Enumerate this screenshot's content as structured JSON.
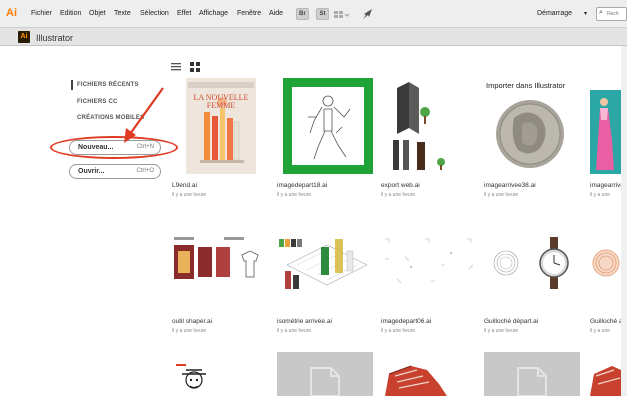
{
  "menubar": {
    "logo": "Ai",
    "items": [
      "Fichier",
      "Edition",
      "Objet",
      "Texte",
      "Sélection",
      "Effet",
      "Affichage",
      "Fenêtre",
      "Aide"
    ],
    "bridge_btn": "Br",
    "stock_btn": "St",
    "workspace": "Démarrage",
    "search_placeholder": "Rech"
  },
  "appbar": {
    "logo": "Ai",
    "title": "Illustrator"
  },
  "sidebar": {
    "links": [
      "FICHIERS RÉCENTS",
      "FICHIERS CC",
      "CRÉATIONS MOBILES"
    ],
    "new_button": {
      "label": "Nouveau...",
      "shortcut": "Ctrl+N"
    },
    "open_button": {
      "label": "Ouvrir...",
      "shortcut": "Ctrl+O"
    }
  },
  "files": [
    {
      "name": "L9end.ai",
      "time": "il y a une heure",
      "thumb_title": "LA NOUVELLE FEMME"
    },
    {
      "name": "imagedepart18.ai",
      "time": "il y a une heure"
    },
    {
      "name": "export web.ai",
      "time": "il y a une heure"
    },
    {
      "name": "imagearrivee38.ai",
      "time": "il y a une heure",
      "thumb_title": "Importer dans Illustrator"
    },
    {
      "name": "imagearrive",
      "time": "il y a une"
    },
    {
      "name": "outil shaper.ai",
      "time": "il y a une heure"
    },
    {
      "name": "isométrie arrivée.ai",
      "time": "il y a une heure"
    },
    {
      "name": "imagedepart06.ai",
      "time": "il y a une heure"
    },
    {
      "name": "Guilloché départ.ai",
      "time": "il y a une heure"
    },
    {
      "name": "Guilloché ar",
      "time": "il y a une"
    }
  ],
  "colors": {
    "accent": "#e03a23",
    "ai_orange": "#ff9a00",
    "ai_dark": "#2a1b00",
    "thumb_green": "#1fa338"
  }
}
